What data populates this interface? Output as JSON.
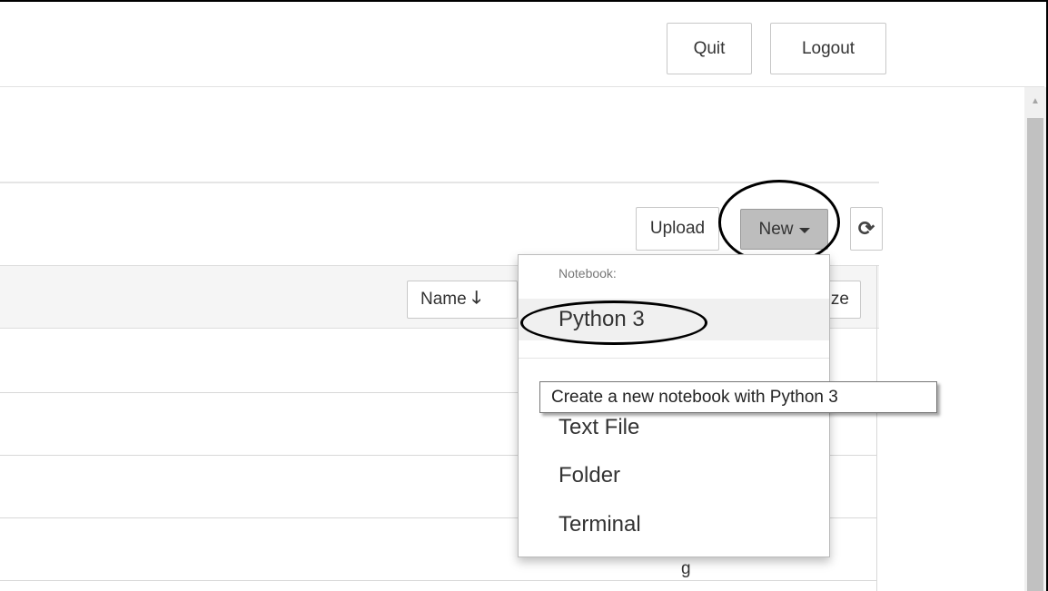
{
  "header": {
    "quit_label": "Quit",
    "logout_label": "Logout"
  },
  "toolbar": {
    "upload_label": "Upload",
    "new_label": "New",
    "refresh_icon": "refresh-icon"
  },
  "list_header": {
    "name_label": "Name",
    "name_sort_icon": "arrow-down-icon",
    "size_label": "ze"
  },
  "list": {
    "partial_row_text": "g"
  },
  "new_menu": {
    "section_header": "Notebook:",
    "items": [
      {
        "label": "Python 3"
      },
      {
        "label": "Text File"
      },
      {
        "label": "Folder"
      },
      {
        "label": "Terminal"
      }
    ]
  },
  "tooltip": {
    "text": "Create a new notebook with Python 3"
  },
  "colors": {
    "new_button_bg": "#bdbdbd",
    "annotation_circle": "#000000"
  }
}
